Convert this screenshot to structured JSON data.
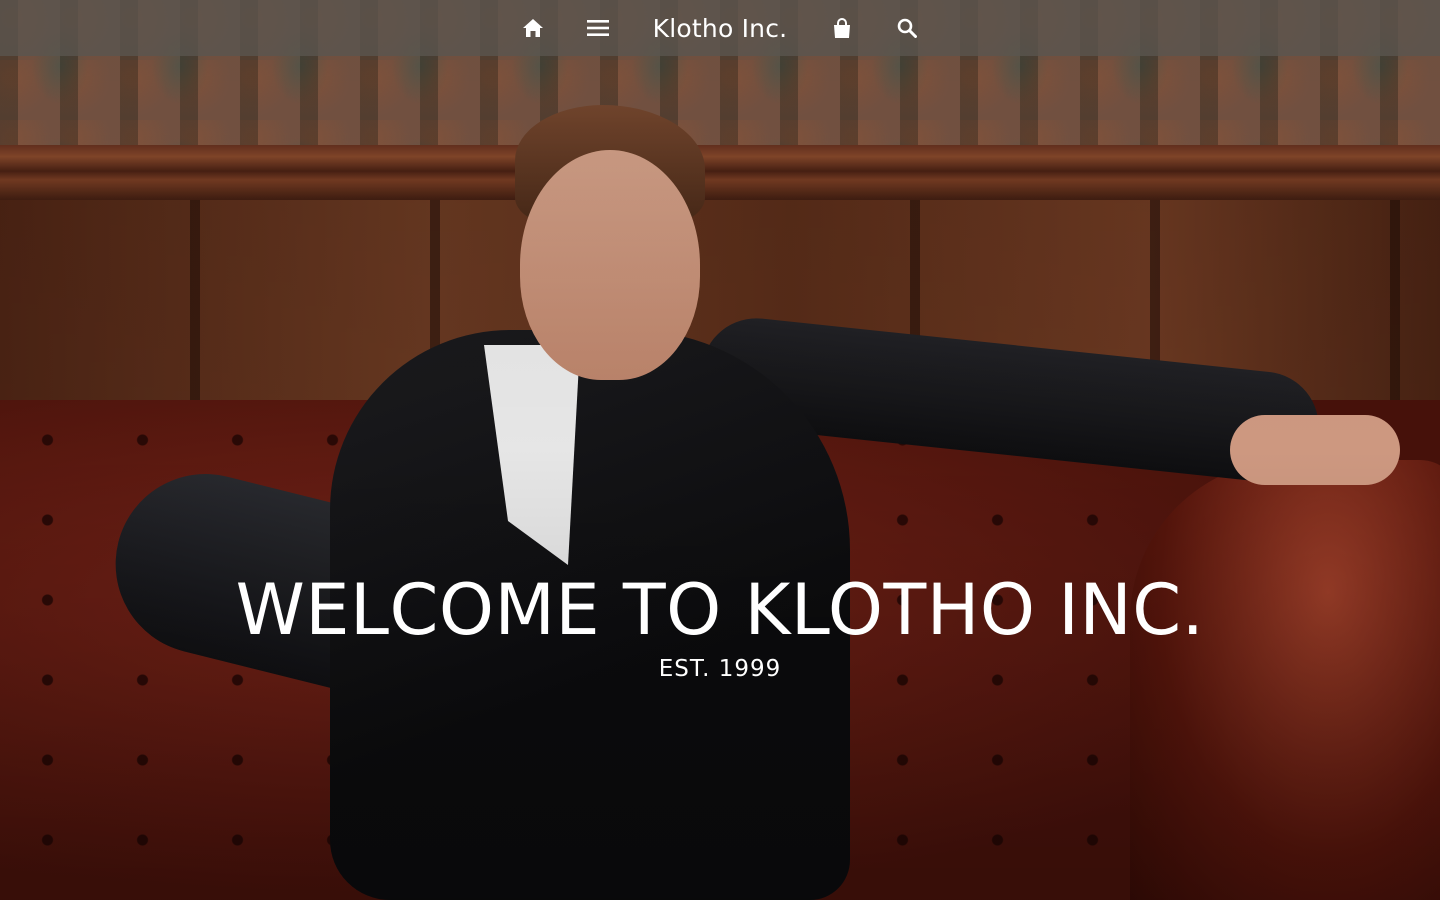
{
  "nav": {
    "brand": "Klotho Inc.",
    "icons": [
      "home-icon",
      "menu-icon",
      "shopping-bag-icon",
      "search-icon"
    ]
  },
  "hero": {
    "title": "WELCOME TO KLOTHO INC.",
    "subtitle": "EST. 1999"
  },
  "colors": {
    "navbar_bg": "#5a5650",
    "text": "#ffffff"
  }
}
